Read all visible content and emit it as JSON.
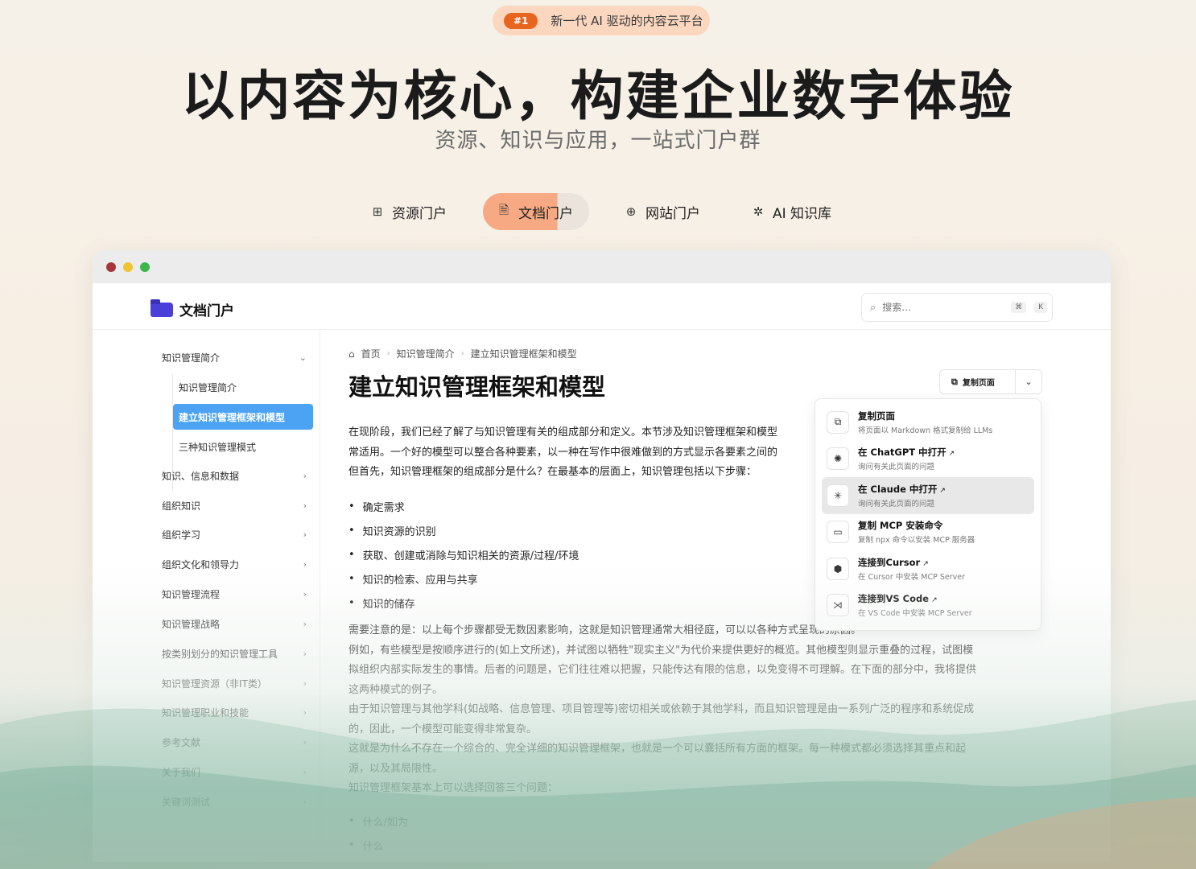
{
  "badge": {
    "number": "#1",
    "text": "新一代 AI 驱动的内容云平台"
  },
  "hero": {
    "title": "以内容为核心，构建企业数字体验",
    "subtitle": "资源、知识与应用，一站式门户群"
  },
  "portal_tabs": [
    {
      "label": "资源门户",
      "icon": "plus-square-icon",
      "active": false
    },
    {
      "label": "文档门户",
      "icon": "document-icon",
      "active": true
    },
    {
      "label": "网站门户",
      "icon": "globe-icon",
      "active": false
    },
    {
      "label": "AI 知识库",
      "icon": "sparkle-icon",
      "active": false
    }
  ],
  "app": {
    "logo_text": "文档门户",
    "search": {
      "placeholder": "搜索...",
      "shortcut_mod": "⌘",
      "shortcut_key": "K"
    }
  },
  "sidebar": {
    "section": {
      "label": "知识管理简介",
      "expanded": true
    },
    "sub_items": [
      {
        "label": "知识管理简介",
        "active": false
      },
      {
        "label": "建立知识管理框架和模型",
        "active": true
      },
      {
        "label": "三种知识管理模式",
        "active": false
      }
    ],
    "items": [
      "知识、信息和数据",
      "组织知识",
      "组织学习",
      "组织文化和领导力",
      "知识管理流程",
      "知识管理战略",
      "按类别划分的知识管理工具",
      "知识管理资源（非IT类）",
      "知识管理职业和技能",
      "参考文献",
      "关于我们",
      "关键词测试"
    ]
  },
  "breadcrumb": [
    "首页",
    "知识管理简介",
    "建立知识管理框架和模型"
  ],
  "page": {
    "title": "建立知识管理框架和模型",
    "copy_button": "复制页面",
    "intro": [
      "在现阶段，我们已经了解了与知识管理有关的组成部分和定义。本节涉及知识管理框架和模型",
      "常适用。一个好的模型可以整合各种要素，以一种在写作中很难做到的方式显示各要素之间的",
      "但首先，知识管理框架的组成部分是什么？在最基本的层面上，知识管理包括以下步骤："
    ],
    "steps": [
      "确定需求",
      "知识资源的识别",
      "获取、创建或消除与知识相关的资源/过程/环境",
      "知识的检索、应用与共享",
      "知识的储存"
    ],
    "body": [
      "需要注意的是：以上每个步骤都受无数因素影响，这就是知识管理通常大相径庭，可以以各种方式呈现的原因。",
      "例如，有些模型是按顺序进行的(如上文所述)，并试图以牺牲\"现实主义\"为代价来提供更好的概览。其他模型则显示重叠的过程，试图模",
      "拟组织内部实际发生的事情。后者的问题是，它们往往难以把握，只能传达有限的信息，以免变得不可理解。在下面的部分中，我将提供",
      "这两种模式的例子。",
      "由于知识管理与其他学科(如战略、信息管理、项目管理等)密切相关或依赖于其他学科，而且知识管理是由一系列广泛的程序和系统促成",
      "的，因此，一个模型可能变得非常复杂。",
      "这就是为什么不存在一个综合的、完全详细的知识管理框架，也就是一个可以囊括所有方面的框架。每一种模式都必须选择其重点和起",
      "源，以及其局限性。",
      "知识管理框架基本上可以选择回答三个问题："
    ],
    "questions": [
      "什么/如为",
      "什么"
    ]
  },
  "menu": [
    {
      "title": "复制页面",
      "desc": "将页面以 Markdown 格式复制给 LLMs",
      "icon": "copy-icon",
      "external": false,
      "highlighted": false
    },
    {
      "title": "在 ChatGPT 中打开",
      "desc": "询问有关此页面的问题",
      "icon": "chatgpt-icon",
      "external": true,
      "highlighted": false
    },
    {
      "title": "在 Claude 中打开",
      "desc": "询问有关此页面的问题",
      "icon": "claude-icon",
      "external": true,
      "highlighted": true
    },
    {
      "title": "复制 MCP 安装命令",
      "desc": "复制 npx 命令以安装 MCP 服务器",
      "icon": "terminal-icon",
      "external": false,
      "highlighted": false
    },
    {
      "title": "连接到Cursor",
      "desc": "在 Cursor 中安装 MCP Server",
      "icon": "cursor-icon",
      "external": true,
      "highlighted": false
    },
    {
      "title": "连接到VS Code",
      "desc": "在 VS Code 中安装 MCP Server",
      "icon": "vscode-icon",
      "external": true,
      "highlighted": false
    }
  ],
  "colors": {
    "accent_orange": "#e8651f",
    "active_tab": "#f6a983",
    "sidebar_active": "#4da3f3"
  }
}
